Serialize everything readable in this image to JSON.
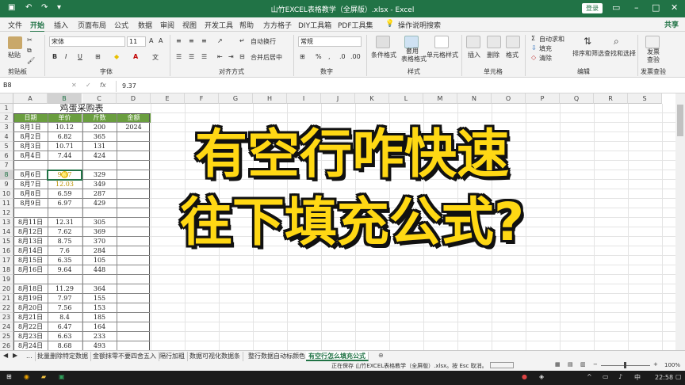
{
  "window": {
    "title": "山竹EXCEL表格教学（全屏版）.xlsx - Excel",
    "login": "登录"
  },
  "tabs": [
    "文件",
    "开始",
    "插入",
    "页面布局",
    "公式",
    "数据",
    "审阅",
    "视图",
    "开发工具",
    "帮助",
    "方方格子",
    "DIY工具箱",
    "PDF工具集"
  ],
  "active_tab": "开始",
  "tell_me": "操作说明搜索",
  "share": "共享",
  "ribbon": {
    "paste": "粘贴",
    "clipboard": "剪贴板",
    "font_name": "宋体",
    "font_size": "11",
    "font_group": "字体",
    "wrap": "自动换行",
    "merge": "合并后居中",
    "align_group": "对齐方式",
    "number_format": "常规",
    "number_group": "数字",
    "cond_format": "条件格式",
    "table_format": "套用\n表格格式",
    "cell_style": "单元格样式",
    "style_group": "样式",
    "insert": "插入",
    "delete": "删除",
    "format": "格式",
    "cells_group": "单元格",
    "autosum": "自动求和",
    "fill": "填充",
    "clear": "清除",
    "sort": "排序和筛选",
    "find": "查找和选择",
    "edit_group": "编辑",
    "invoice": "发票\n查验",
    "invoice_group": "发票查验"
  },
  "formula_bar": {
    "name_box": "B8",
    "value": "9.37"
  },
  "columns": [
    "A",
    "B",
    "C",
    "D",
    "E",
    "F",
    "G",
    "H",
    "I",
    "J",
    "K",
    "L",
    "M",
    "N",
    "O",
    "P",
    "Q",
    "R",
    "S"
  ],
  "rows": [
    "1",
    "2",
    "3",
    "4",
    "5",
    "6",
    "7",
    "8",
    "9",
    "10",
    "11",
    "12",
    "13",
    "14",
    "15",
    "16",
    "17",
    "18",
    "19",
    "20",
    "21",
    "22",
    "23",
    "24",
    "25",
    "26",
    "27"
  ],
  "table": {
    "title": "鸡蛋采购表",
    "headers": [
      "日期",
      "单价",
      "斤数",
      "金额"
    ],
    "d3": "2024",
    "data": [
      {
        "row": 3,
        "a": "8月1日",
        "b": "10.12",
        "c": "200"
      },
      {
        "row": 4,
        "a": "8月2日",
        "b": "6.82",
        "c": "365"
      },
      {
        "row": 5,
        "a": "8月3日",
        "b": "10.71",
        "c": "131"
      },
      {
        "row": 6,
        "a": "8月4日",
        "b": "7.44",
        "c": "424"
      },
      {
        "row": 8,
        "a": "8月6日",
        "b": "9.37",
        "c": "329"
      },
      {
        "row": 9,
        "a": "8月7日",
        "b": "12.03",
        "c": "349"
      },
      {
        "row": 10,
        "a": "8月8日",
        "b": "6.59",
        "c": "287"
      },
      {
        "row": 11,
        "a": "8月9日",
        "b": "6.97",
        "c": "429"
      },
      {
        "row": 13,
        "a": "8月11日",
        "b": "12.31",
        "c": "305"
      },
      {
        "row": 14,
        "a": "8月12日",
        "b": "7.62",
        "c": "369"
      },
      {
        "row": 15,
        "a": "8月13日",
        "b": "8.75",
        "c": "370"
      },
      {
        "row": 16,
        "a": "8月14日",
        "b": "7.6",
        "c": "284"
      },
      {
        "row": 17,
        "a": "8月15日",
        "b": "6.35",
        "c": "105"
      },
      {
        "row": 18,
        "a": "8月16日",
        "b": "9.64",
        "c": "448"
      },
      {
        "row": 20,
        "a": "8月18日",
        "b": "11.29",
        "c": "364"
      },
      {
        "row": 21,
        "a": "8月19日",
        "b": "7.97",
        "c": "155"
      },
      {
        "row": 22,
        "a": "8月20日",
        "b": "7.56",
        "c": "153"
      },
      {
        "row": 23,
        "a": "8月21日",
        "b": "8.4",
        "c": "185"
      },
      {
        "row": 24,
        "a": "8月22日",
        "b": "6.47",
        "c": "164"
      },
      {
        "row": 25,
        "a": "8月23日",
        "b": "6.63",
        "c": "233"
      },
      {
        "row": 26,
        "a": "8月24日",
        "b": "8.68",
        "c": "493"
      },
      {
        "row": 27,
        "a": "8月25日",
        "b": "6.53",
        "c": "105"
      }
    ]
  },
  "overlay": {
    "line1": "有空行咋快速",
    "line2": "往下填充公式?"
  },
  "sheet_tabs": [
    "...",
    "批量删除特定数据",
    "金额抹零不要四舍五入",
    "隔行加粗",
    "数据可视化数据条",
    "整行数据自动标颜色",
    "有空行怎么填充公式"
  ],
  "active_sheet": "有空行怎么填充公式",
  "status": {
    "text": "正在保存 山竹EXCEL表格教学（全屏版）.xlsx。按 Esc 取消。",
    "zoom": "100%"
  },
  "taskbar": {
    "time": "22:58"
  },
  "colors": {
    "excel_green": "#217346",
    "header_fill": "#6a9e3f",
    "overlay_yellow": "#ffd814"
  }
}
